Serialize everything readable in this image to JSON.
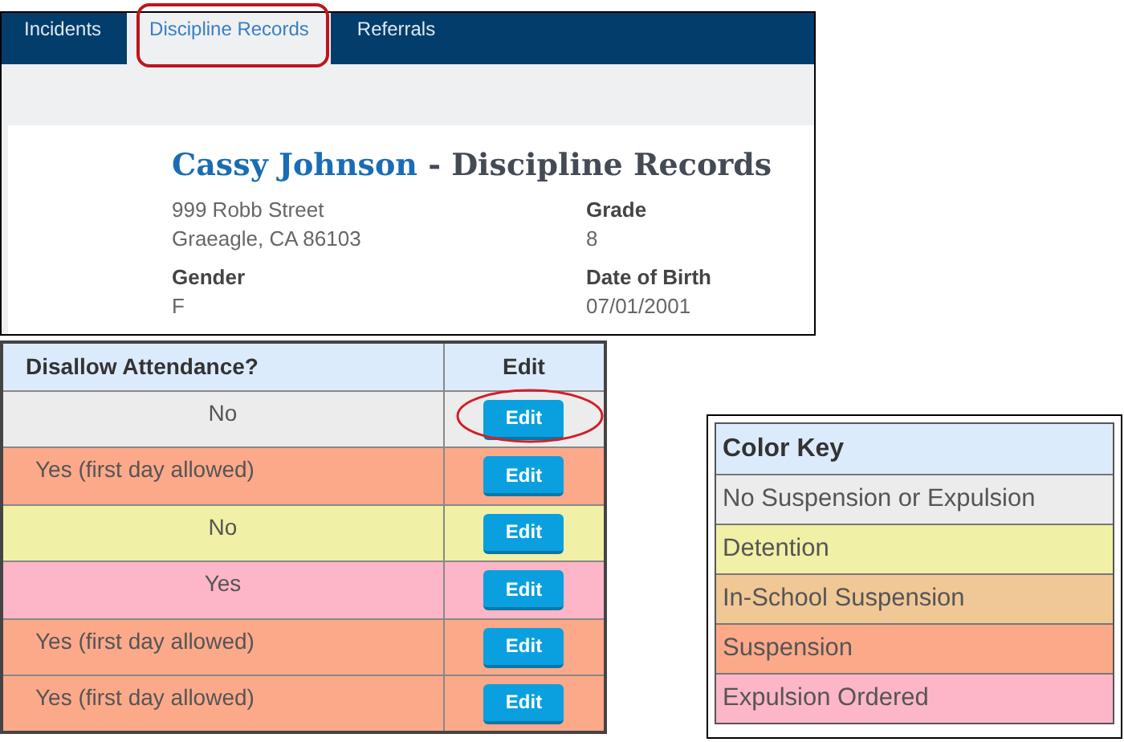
{
  "tabs": [
    {
      "label": "Incidents",
      "selected": false
    },
    {
      "label": "Discipline Records",
      "selected": true
    },
    {
      "label": "Referrals",
      "selected": false
    }
  ],
  "student": {
    "name": "Cassy Johnson",
    "title_suffix": " - Discipline Records",
    "address": [
      "999 Robb Street",
      "Graeagle, CA 86103"
    ],
    "fields": [
      {
        "label": "Grade",
        "value": "8"
      },
      {
        "label": "Gender",
        "value": "F"
      },
      {
        "label": "Date of Birth",
        "value": "07/01/2001"
      }
    ]
  },
  "table": {
    "columns": [
      "Disallow Attendance?",
      "Edit"
    ],
    "rows": [
      {
        "disallow": "No",
        "button": "Edit",
        "color": "#ececec",
        "centered": true
      },
      {
        "disallow": "Yes (first day allowed)",
        "button": "Edit",
        "color": "#fca98a",
        "centered": false
      },
      {
        "disallow": "No",
        "button": "Edit",
        "color": "#f0f0a6",
        "centered": true
      },
      {
        "disallow": "Yes",
        "button": "Edit",
        "color": "#fcb6c8",
        "centered": true
      },
      {
        "disallow": "Yes (first day allowed)",
        "button": "Edit",
        "color": "#fca98a",
        "centered": false
      },
      {
        "disallow": "Yes (first day allowed)",
        "button": "Edit",
        "color": "#fca98a",
        "centered": false
      }
    ]
  },
  "color_key": {
    "title": "Color Key",
    "items": [
      {
        "label": "No Suspension or Expulsion",
        "color": "#ececec"
      },
      {
        "label": "Detention",
        "color": "#f0f0a6"
      },
      {
        "label": "In-School Suspension",
        "color": "#f0c896"
      },
      {
        "label": "Suspension",
        "color": "#fca98a"
      },
      {
        "label": "Expulsion Ordered",
        "color": "#fcb6c8"
      }
    ]
  }
}
